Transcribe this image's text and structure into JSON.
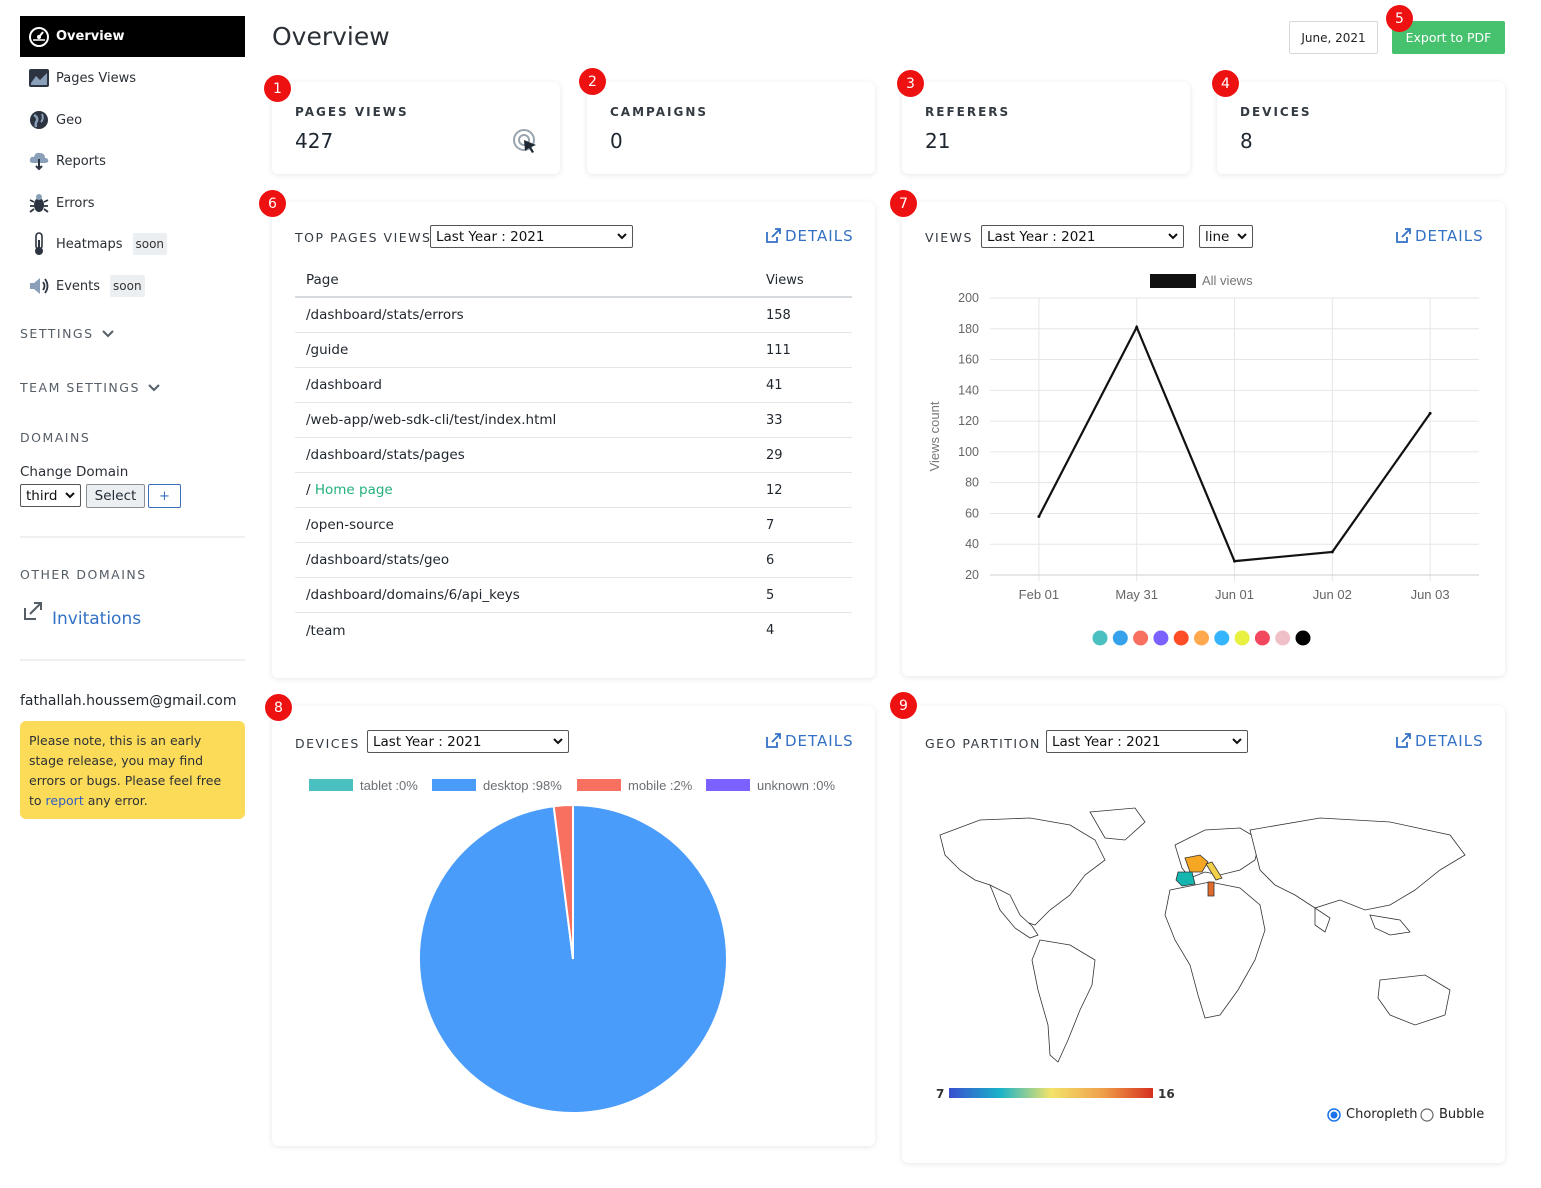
{
  "sidebar": {
    "active": "Overview",
    "items": [
      {
        "label": "Pages Views"
      },
      {
        "label": "Geo"
      },
      {
        "label": "Reports"
      },
      {
        "label": "Errors"
      },
      {
        "label": "Heatmaps",
        "badge": "soon"
      },
      {
        "label": "Events",
        "badge": "soon"
      }
    ],
    "settings": "SETTINGS",
    "team_settings": "TEAM SETTINGS",
    "domains": "DOMAINS",
    "change_domain": "Change Domain",
    "domain_select": "third",
    "select_button": "Select",
    "add_button": "+",
    "other_domains": "OTHER DOMAINS",
    "invitations": "Invitations",
    "email": "fathallah.houssem@gmail.com",
    "notice": {
      "text": "Please note, this is an early stage release, you may find errors or bugs. Please feel free to",
      "link": "report",
      "tail": "any error."
    }
  },
  "header": {
    "title": "Overview",
    "date": "June, 2021",
    "export": "Export to PDF"
  },
  "badges": [
    "1",
    "2",
    "3",
    "4",
    "5",
    "6",
    "7",
    "8",
    "9"
  ],
  "stats": [
    {
      "label": "PAGES VIEWS",
      "value": "427"
    },
    {
      "label": "CAMPAIGNS",
      "value": "0"
    },
    {
      "label": "REFERERS",
      "value": "21"
    },
    {
      "label": "DEVICES",
      "value": "8"
    }
  ],
  "top_pages": {
    "title": "TOP PAGES VIEWS",
    "period": "Last Year : 2021",
    "details": "DETAILS",
    "columns": [
      "Page",
      "Views"
    ],
    "rows": [
      {
        "page": "/dashboard/stats/errors",
        "views": "158"
      },
      {
        "page": "/guide",
        "views": "111"
      },
      {
        "page": "/dashboard",
        "views": "41"
      },
      {
        "page": "/web-app/web-sdk-cli/test/index.html",
        "views": "33"
      },
      {
        "page": "/dashboard/stats/pages",
        "views": "29"
      },
      {
        "page": "/ ",
        "page_link": "Home page",
        "views": "12"
      },
      {
        "page": "/open-source",
        "views": "7"
      },
      {
        "page": "/dashboard/stats/geo",
        "views": "6"
      },
      {
        "page": "/dashboard/domains/6/api_keys",
        "views": "5"
      },
      {
        "page": "/team",
        "views": "4"
      }
    ]
  },
  "views_panel": {
    "title": "VIEWS",
    "period": "Last Year : 2021",
    "chart_type": "line",
    "details": "DETAILS",
    "palette": [
      "#4bc0c0",
      "#36a2eb",
      "#f87060",
      "#7b61ff",
      "#ff4d26",
      "#ffa84d",
      "#36b5ff",
      "#e8f040",
      "#f2475e",
      "#f0c0c8",
      "#000000"
    ]
  },
  "devices_panel": {
    "title": "DEVICES",
    "period": "Last Year : 2021",
    "details": "DETAILS"
  },
  "geo_panel": {
    "title": "GEO PARTITION",
    "period": "Last Year : 2021",
    "details": "DETAILS",
    "scale_min": "7",
    "scale_max": "16",
    "mode_choropleth": "Choropleth",
    "mode_bubble": "Bubble",
    "selected_mode": "Choropleth"
  },
  "chart_data": [
    {
      "type": "line",
      "x": [
        "Feb 01",
        "May 31",
        "Jun 01",
        "Jun 02",
        "Jun 03"
      ],
      "series": [
        {
          "name": "All views",
          "values": [
            58,
            181,
            29,
            35,
            125
          ],
          "color": "#111111"
        }
      ],
      "ylabel": "Views count",
      "ylim": [
        20,
        200
      ],
      "yticks": [
        20,
        40,
        60,
        80,
        100,
        120,
        140,
        160,
        180,
        200
      ],
      "grid": true,
      "legend": "top"
    },
    {
      "type": "pie",
      "categories": [
        "tablet",
        "desktop",
        "mobile",
        "unknown"
      ],
      "values": [
        0,
        98,
        2,
        0
      ],
      "legend_labels": [
        "tablet :0%",
        "desktop :98%",
        "mobile :2%",
        "unknown :0%"
      ],
      "colors": [
        "#4bc0c0",
        "#4a9cfa",
        "#f87060",
        "#7b61ff"
      ],
      "legend": "top"
    }
  ]
}
